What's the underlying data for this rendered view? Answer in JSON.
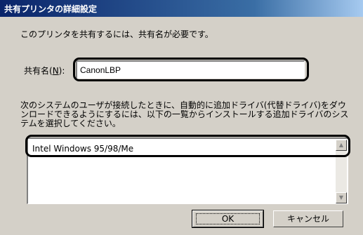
{
  "window": {
    "title": "共有プリンタの詳細設定"
  },
  "intro_text": "このプリンタを共有するには、共有名が必要です。",
  "share_name": {
    "label_prefix": "共有名(",
    "label_accel": "N",
    "label_suffix": "):",
    "value": "CanonLBP"
  },
  "description_text": "次のシステムのユーザが接続したときに、自動的に追加ドライバ(代替ドライバ)をダウンロードできるようにするには、以下の一覧からインストールする追加ドライバのシステムを選択してください。",
  "driver_list": {
    "items": [
      "Intel Windows 95/98/Me"
    ]
  },
  "icons": {
    "scroll_up": "▲",
    "scroll_down": "▼"
  },
  "buttons": {
    "ok": "OK",
    "cancel": "キャンセル"
  },
  "colors": {
    "titlebar_start": "#0a246a",
    "dialog_face": "#d4d0c8"
  }
}
